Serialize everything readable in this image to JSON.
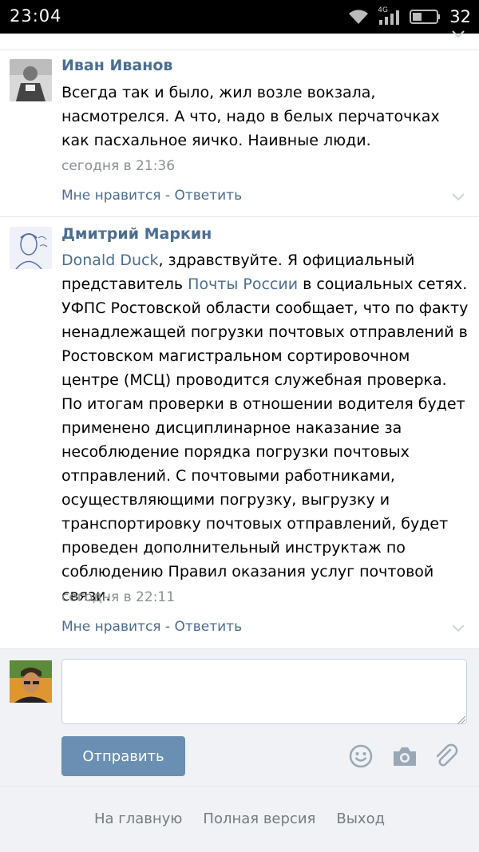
{
  "status_bar": {
    "time": "23:04",
    "network": "4G",
    "battery": "32"
  },
  "comments": [
    {
      "author": "Иван Иванов",
      "text": "Всегда так и было, жил возле вокзала, насмотрелся. А что, надо в белых перчаточках как пасхальное яичко. Наивные люди.",
      "date": "сегодня в 21:36",
      "like_label": "Мне нравится",
      "separator": " - ",
      "reply_label": "Ответить"
    },
    {
      "author": "Дмитрий Маркин",
      "mention": "Donald Duck",
      "text_1": ", здравствуйте. Я официальный представитель ",
      "link": "Почты России",
      "text_2": " в социальных сетях. УФПС Ростовской области сообщает, что по факту ненадлежащей погрузки почтовых отправлений в Ростовском магистральном сортировочном центре (МСЦ) проводится служебная проверка. По итогам проверки в отношении водителя будет применено дисциплинарное наказание за несоблюдение порядка погрузки почтовых отправлений. С почтовыми работниками, осуществляющими погрузку, выгрузку и транспортировку почтовых отправлений, будет проведен дополнительный инструктаж по соблюдению Правил оказания услуг почтовой связи.",
      "date": "сегодня в 22:11",
      "like_label": "Мне нравится",
      "separator": " - ",
      "reply_label": "Ответить"
    }
  ],
  "reply": {
    "input_value": "",
    "send_label": "Отправить",
    "icons": [
      "smile-icon",
      "camera-icon",
      "paperclip-icon"
    ]
  },
  "footer": {
    "links": [
      "На главную",
      "Полная версия",
      "Выход"
    ]
  },
  "colors": {
    "link": "#4a6d92",
    "button": "#6a8fb3",
    "meta": "#8a8f96",
    "panel": "#f0f2f5"
  }
}
